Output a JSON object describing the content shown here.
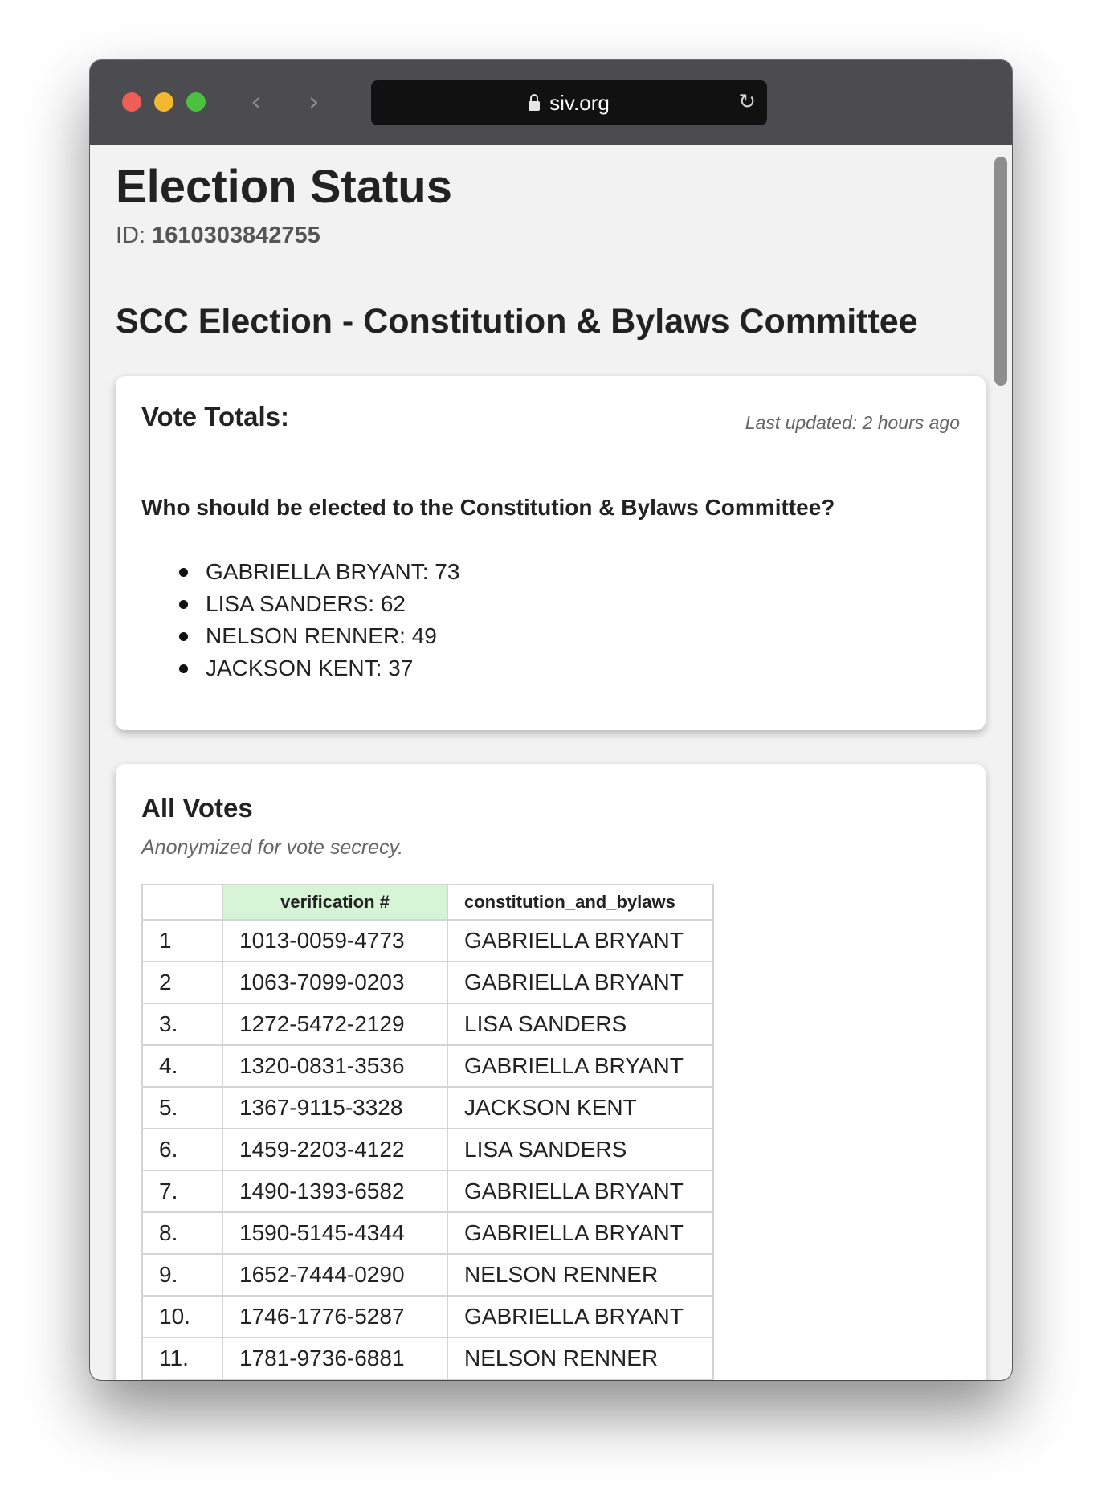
{
  "browser": {
    "url": "siv.org"
  },
  "page": {
    "title": "Election Status",
    "id_label": "ID:",
    "id_value": "1610303842755",
    "election_name": "SCC Election - Constitution & Bylaws Committee"
  },
  "totals": {
    "title": "Vote Totals:",
    "last_updated": "Last updated: 2 hours ago",
    "question": "Who should be elected to the Constitution & Bylaws Committee?",
    "results": [
      {
        "text": "GABRIELLA BRYANT: 73"
      },
      {
        "text": "LISA SANDERS: 62"
      },
      {
        "text": "NELSON RENNER: 49"
      },
      {
        "text": "JACKSON KENT: 37"
      }
    ]
  },
  "votes": {
    "title": "All Votes",
    "subtitle": "Anonymized for vote secrecy.",
    "columns": [
      "",
      "verification #",
      "constitution_and_bylaws"
    ],
    "rows": [
      {
        "index": "1",
        "verification": "1013-0059-4773",
        "choice": "GABRIELLA BRYANT"
      },
      {
        "index": "2",
        "verification": "1063-7099-0203",
        "choice": "GABRIELLA BRYANT"
      },
      {
        "index": "3.",
        "verification": "1272-5472-2129",
        "choice": "LISA SANDERS"
      },
      {
        "index": "4.",
        "verification": "1320-0831-3536",
        "choice": "GABRIELLA BRYANT"
      },
      {
        "index": "5.",
        "verification": "1367-9115-3328",
        "choice": "JACKSON KENT"
      },
      {
        "index": "6.",
        "verification": "1459-2203-4122",
        "choice": "LISA SANDERS"
      },
      {
        "index": "7.",
        "verification": "1490-1393-6582",
        "choice": "GABRIELLA BRYANT"
      },
      {
        "index": "8.",
        "verification": "1590-5145-4344",
        "choice": "GABRIELLA BRYANT"
      },
      {
        "index": "9.",
        "verification": "1652-7444-0290",
        "choice": "NELSON RENNER"
      },
      {
        "index": "10.",
        "verification": "1746-1776-5287",
        "choice": "GABRIELLA BRYANT"
      },
      {
        "index": "11.",
        "verification": "1781-9736-6881",
        "choice": "NELSON RENNER"
      }
    ]
  }
}
